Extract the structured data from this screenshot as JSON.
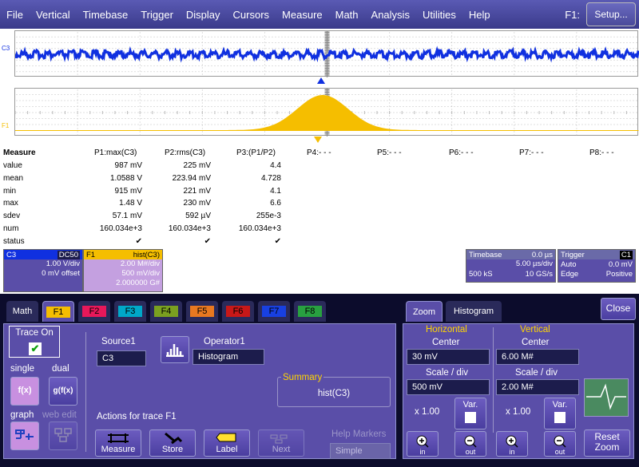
{
  "menu": [
    "File",
    "Vertical",
    "Timebase",
    "Trigger",
    "Display",
    "Cursors",
    "Measure",
    "Math",
    "Analysis",
    "Utilities",
    "Help"
  ],
  "toolbar": {
    "f1_label": "F1:",
    "setup_label": "Setup..."
  },
  "traces": {
    "c3_label": "C3",
    "f1_label": "F1",
    "c3_color": "#1030e0",
    "f1_color": "#f5be00"
  },
  "measure": {
    "title": "Measure",
    "params": [
      "P1:max(C3)",
      "P2:rms(C3)",
      "P3:(P1/P2)",
      "P4:- - -",
      "P5:- - -",
      "P6:- - -",
      "P7:- - -",
      "P8:- - -"
    ],
    "rows": [
      {
        "label": "value",
        "v": [
          "987 mV",
          "225 mV",
          "4.4"
        ]
      },
      {
        "label": "mean",
        "v": [
          "1.0588 V",
          "223.94 mV",
          "4.728"
        ]
      },
      {
        "label": "min",
        "v": [
          "915 mV",
          "221 mV",
          "4.1"
        ]
      },
      {
        "label": "max",
        "v": [
          "1.48 V",
          "230 mV",
          "6.6"
        ]
      },
      {
        "label": "sdev",
        "v": [
          "57.1 mV",
          "592 µV",
          "255e-3"
        ]
      },
      {
        "label": "num",
        "v": [
          "160.034e+3",
          "160.034e+3",
          "160.034e+3"
        ]
      },
      {
        "label": "status",
        "v": [
          "✔",
          "✔",
          "✔"
        ]
      }
    ]
  },
  "descriptors": {
    "c3": {
      "name": "C3",
      "coupling": "DC50",
      "l1": "1.00 V/div",
      "l2": "0 mV offset"
    },
    "f1": {
      "name": "F1",
      "func": "hist(C3)",
      "l1": "2.00 M#/div",
      "l2": "500 mV/div",
      "l3": "2.000000 G#"
    },
    "timebase": {
      "name": "Timebase",
      "delay": "0.0 µs",
      "l1_right": "5.00 µs/div",
      "l2_left": "500 kS",
      "l2_right": "10 GS/s"
    },
    "trigger": {
      "name": "Trigger",
      "src": "C1",
      "l1_left": "Auto",
      "l1_right": "0.0 mV",
      "l2_left": "Edge",
      "l2_right": "Positive"
    }
  },
  "tabs": [
    "Math",
    "F1",
    "F2",
    "F3",
    "F4",
    "F5",
    "F6",
    "F7",
    "F8"
  ],
  "tab_colors": [
    "#3a3a8a",
    "#f5be00",
    "#e8185a",
    "#00a8c8",
    "#7aa020",
    "#e87820",
    "#c81818",
    "#1840e0",
    "#28a040"
  ],
  "math": {
    "trace_on": "Trace On",
    "single": "single",
    "dual": "dual",
    "fx": "f(x)",
    "gfx": "g(f(x)",
    "graph": "graph",
    "web_edit": "web edit",
    "source1_label": "Source1",
    "source1_value": "C3",
    "operator1_label": "Operator1",
    "operator1_value": "Histogram",
    "summary_label": "Summary",
    "summary_value": "hist(C3)",
    "actions_label": "Actions for trace F1",
    "buttons": [
      "Measure",
      "Store",
      "Label",
      "Next"
    ],
    "help_markers_label": "Help Markers",
    "help_markers_value": "Simple"
  },
  "zoom": {
    "tabs": [
      "Zoom",
      "Histogram"
    ],
    "close": "Close",
    "horizontal": "Horizontal",
    "vertical": "Vertical",
    "center": "Center",
    "h_center": "30 mV",
    "v_center": "6.00 M#",
    "scale": "Scale / div",
    "h_scale": "500 mV",
    "v_scale": "2.00 M#",
    "h_factor": "x 1.00",
    "v_factor": "x 1.00",
    "var": "Var.",
    "in": "in",
    "out": "out",
    "reset": "Reset Zoom"
  }
}
